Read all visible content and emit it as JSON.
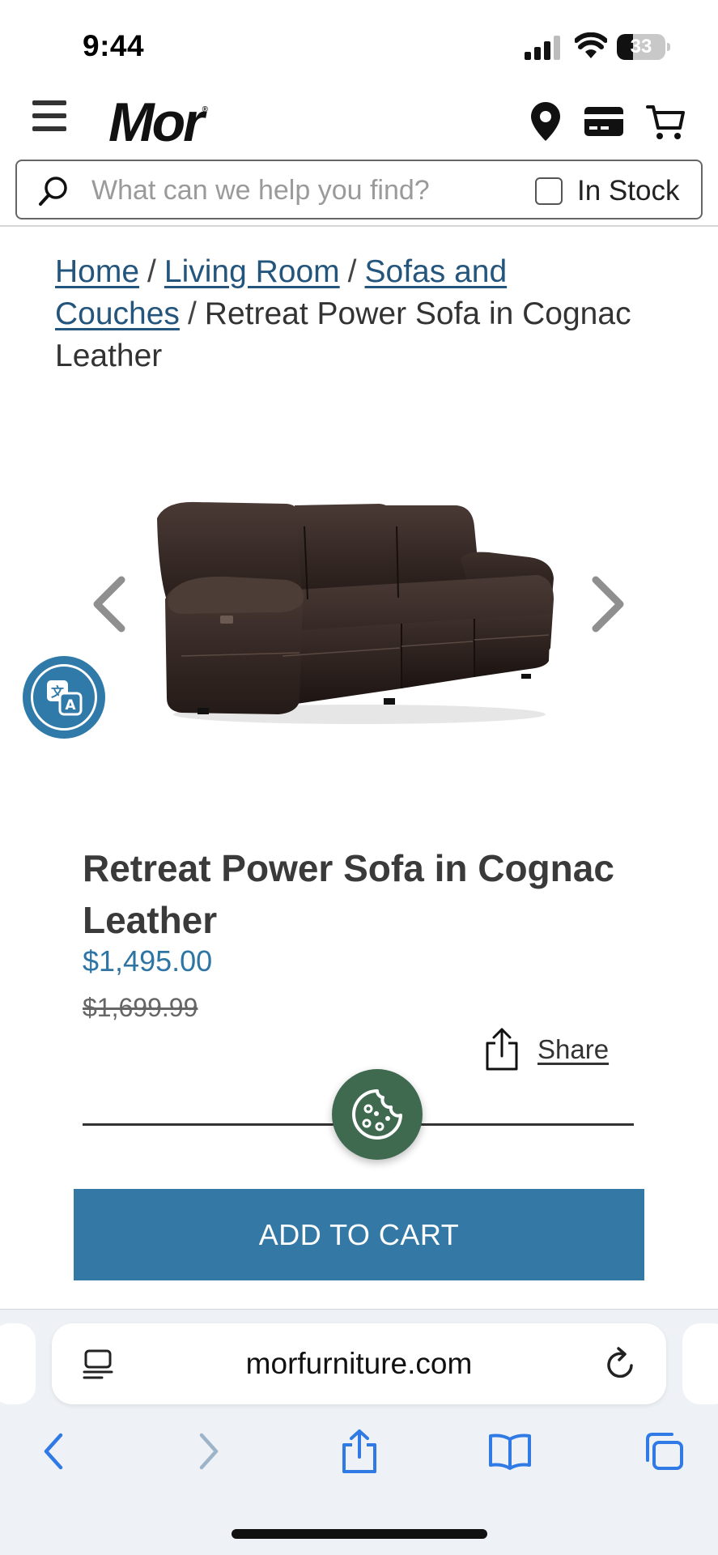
{
  "status_bar": {
    "time": "9:44",
    "battery": "33",
    "battery_level": 0.33
  },
  "header": {
    "logo": "Mor",
    "logo_mark": "®",
    "icons": [
      "menu-icon",
      "location-pin-icon",
      "credit-card-icon",
      "cart-icon"
    ]
  },
  "search": {
    "placeholder": "What can we help you find?",
    "value": "",
    "in_stock_label": "In Stock",
    "in_stock_checked": false
  },
  "breadcrumb": {
    "items": [
      {
        "label": "Home",
        "link": true
      },
      {
        "label": "Living Room",
        "link": true
      },
      {
        "label": "Sofas and Couches",
        "link": true
      },
      {
        "label": "Retreat Power Sofa in Cognac Leather",
        "link": false
      }
    ],
    "separator": "/"
  },
  "product": {
    "title": "Retreat Power Sofa in Cognac Leather",
    "price": "$1,495.00",
    "original_price": "$1,699.99",
    "share_label": "Share",
    "add_to_cart_label": "ADD TO CART"
  },
  "browser": {
    "url": "morfurniture.com"
  },
  "colors": {
    "link": "#24557c",
    "price": "#2e75a4",
    "button": "#3479a6",
    "cookie": "#3f6a4f",
    "translate": "#2f7aa8"
  }
}
